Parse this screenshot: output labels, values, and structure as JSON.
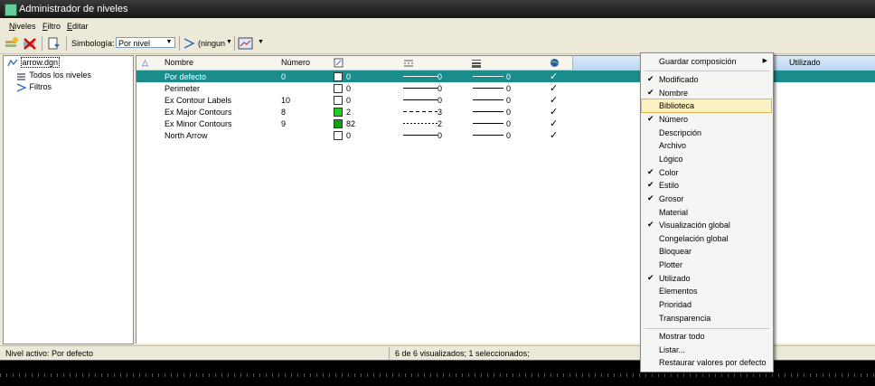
{
  "window": {
    "title": "Administrador de niveles"
  },
  "menubar": [
    "Niveles",
    "Filtro",
    "Editar"
  ],
  "toolbar": {
    "symbology_label": "Simbología:",
    "symbology_value": "Por nivel",
    "filter_value": "(ningun"
  },
  "tree": {
    "file": "arrow.dgn",
    "all_levels": "Todos los niveles",
    "filters": "Filtros"
  },
  "columns": {
    "name": "Nombre",
    "number": "Número",
    "used": "Utilizado"
  },
  "rows": [
    {
      "name": "Por defecto",
      "number": "0",
      "color": "0",
      "style": "0",
      "weight": "0",
      "global": "✓",
      "swatch": "#ffffff",
      "line": "solid",
      "selected": true
    },
    {
      "name": "Perimeter",
      "number": "",
      "color": "0",
      "style": "0",
      "weight": "0",
      "global": "✓",
      "swatch": "#ffffff",
      "line": "solid"
    },
    {
      "name": "Ex Contour Labels",
      "number": "10",
      "color": "0",
      "style": "0",
      "weight": "0",
      "global": "✓",
      "swatch": "#ffffff",
      "line": "solid"
    },
    {
      "name": "Ex Major Contours",
      "number": "8",
      "color": "2",
      "style": "3",
      "weight": "0",
      "global": "✓",
      "swatch": "#22cc22",
      "line": "dashed"
    },
    {
      "name": "Ex Minor Contours",
      "number": "9",
      "color": "82",
      "style": "2",
      "weight": "0",
      "global": "✓",
      "swatch": "#11a011",
      "line": "dotted"
    },
    {
      "name": "North Arrow",
      "number": "",
      "color": "0",
      "style": "0",
      "weight": "0",
      "global": "✓",
      "swatch": "#ffffff",
      "line": "solid"
    }
  ],
  "status": {
    "active_level": "Nivel activo: Por defecto",
    "count": "6 de 6 visualizados; 1 seleccionados;"
  },
  "context_menu": {
    "save_composition": "Guardar composición",
    "items": [
      {
        "label": "Modificado",
        "checked": true
      },
      {
        "label": "Nombre",
        "checked": true
      },
      {
        "label": "Biblioteca",
        "checked": false,
        "highlight": true
      },
      {
        "label": "Número",
        "checked": true
      },
      {
        "label": "Descripción",
        "checked": false
      },
      {
        "label": "Archivo",
        "checked": false
      },
      {
        "label": "Lógico",
        "checked": false
      },
      {
        "label": "Color",
        "checked": true
      },
      {
        "label": "Estilo",
        "checked": true
      },
      {
        "label": "Grosor",
        "checked": true
      },
      {
        "label": "Material",
        "checked": false
      },
      {
        "label": "Visualización global",
        "checked": true
      },
      {
        "label": "Congelación global",
        "checked": false
      },
      {
        "label": "Bloquear",
        "checked": false
      },
      {
        "label": "Plotter",
        "checked": false
      },
      {
        "label": "Utilizado",
        "checked": true
      },
      {
        "label": "Elementos",
        "checked": false
      },
      {
        "label": "Prioridad",
        "checked": false
      },
      {
        "label": "Transparencia",
        "checked": false
      }
    ],
    "show_all": "Mostrar todo",
    "list": "Listar...",
    "restore_defaults": "Restaurar valores por defecto"
  },
  "colors": {
    "selection": "#1a8c8c",
    "menu_highlight": "#fcf1c1"
  }
}
